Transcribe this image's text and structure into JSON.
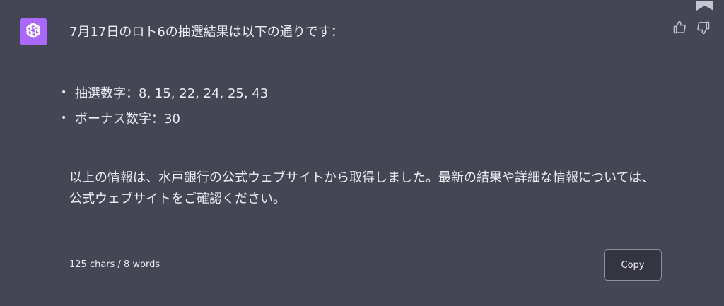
{
  "message": {
    "intro": "7月17日のロト6の抽選結果は以下の通りです：",
    "results": [
      {
        "bullet": "•",
        "text": "抽選数字：8, 15, 22, 24, 25, 43"
      },
      {
        "bullet": "•",
        "text": "ボーナス数字：30"
      }
    ],
    "closing": "以上の情報は、水戸銀行の公式ウェブサイトから取得しました。最新の結果や詳細な情報については、公式ウェブサイトをご確認ください。"
  },
  "footer": {
    "count": "125 chars / 8 words",
    "copy_label": "Copy"
  },
  "icons": {
    "avatar": "openai-logo-icon",
    "thumbs_up": "thumbs-up-icon",
    "thumbs_down": "thumbs-down-icon",
    "bookmark": "bookmark-icon"
  },
  "colors": {
    "background": "#444654",
    "avatar": "#ab68ff",
    "text": "#ececf1"
  }
}
